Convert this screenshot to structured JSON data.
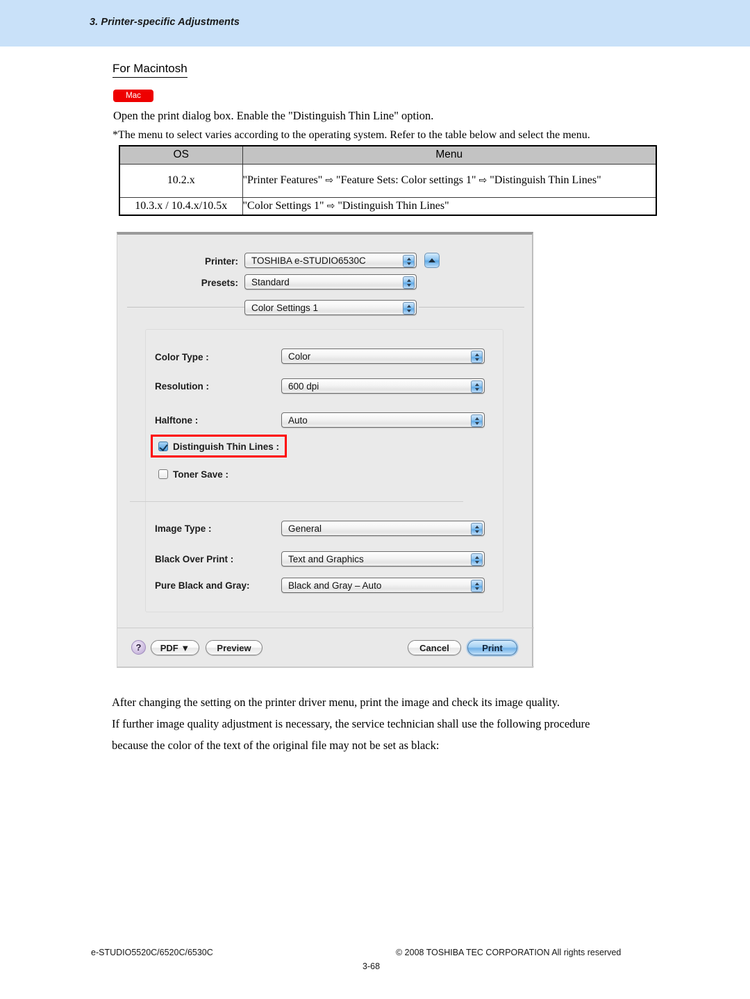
{
  "header": {
    "title": "3. Printer-specific Adjustments",
    "band_color": "#c9e1f9"
  },
  "section": {
    "heading": "For Macintosh",
    "badge": "Mac",
    "badge_color": "#ee0000"
  },
  "body": {
    "open_dialog_line": "Open the print dialog box.  Enable the \"Distinguish Thin Line\" option.",
    "note_line": "*The menu to select varies according to the operating system.  Refer to the table below and select the menu.",
    "after_line_1": "After changing the setting on the printer driver menu, print the image and check its image quality.",
    "after_line_2": "If further image quality adjustment is necessary, the service technician shall use the following procedure",
    "after_line_3": "because the color of the text of the original file may not be set as black:"
  },
  "os_table": {
    "headers": [
      "OS",
      "Menu"
    ],
    "rows": [
      {
        "os": "10.2.x",
        "menu_part_1": "\"Printer Features\"",
        "menu_arrow_1": "⇨",
        "menu_part_2": "\"Feature Sets: Color settings 1\"",
        "menu_arrow_2": "⇨",
        "menu_part_3": "\"Distinguish Thin Lines\""
      },
      {
        "os": "10.3.x / 10.4.x/10.5x",
        "menu_part_1": "\"Color Settings 1\"",
        "menu_arrow_1": "⇨",
        "menu_part_2": "\"Distinguish Thin Lines\"",
        "menu_arrow_2": "",
        "menu_part_3": ""
      }
    ]
  },
  "print_dialog": {
    "printer_label": "Printer:",
    "printer_value": "TOSHIBA e-STUDIO6530C",
    "presets_label": "Presets:",
    "presets_value": "Standard",
    "pane_value": "Color Settings 1",
    "settings": [
      {
        "label": "Color Type :",
        "value": "Color"
      },
      {
        "label": "Resolution :",
        "value": "600 dpi"
      },
      {
        "label": "Halftone :",
        "value": "Auto"
      },
      {
        "label": "Image Type :",
        "value": "General"
      },
      {
        "label": "Black Over Print :",
        "value": "Text and Graphics"
      },
      {
        "label": "Pure Black and Gray:",
        "value": "Black and Gray – Auto"
      }
    ],
    "checkboxes": [
      {
        "label": "Distinguish Thin Lines :",
        "checked": true,
        "highlighted": true
      },
      {
        "label": "Toner Save :",
        "checked": false,
        "highlighted": false
      }
    ],
    "buttons": {
      "help": "?",
      "pdf": "PDF ▼",
      "preview": "Preview",
      "cancel": "Cancel",
      "print": "Print"
    },
    "highlight_color": "#ff0000"
  },
  "footer": {
    "model": "e-STUDIO5520C/6520C/6530C",
    "copyright": "© 2008 TOSHIBA TEC CORPORATION All rights reserved",
    "page_number": "3-68"
  }
}
